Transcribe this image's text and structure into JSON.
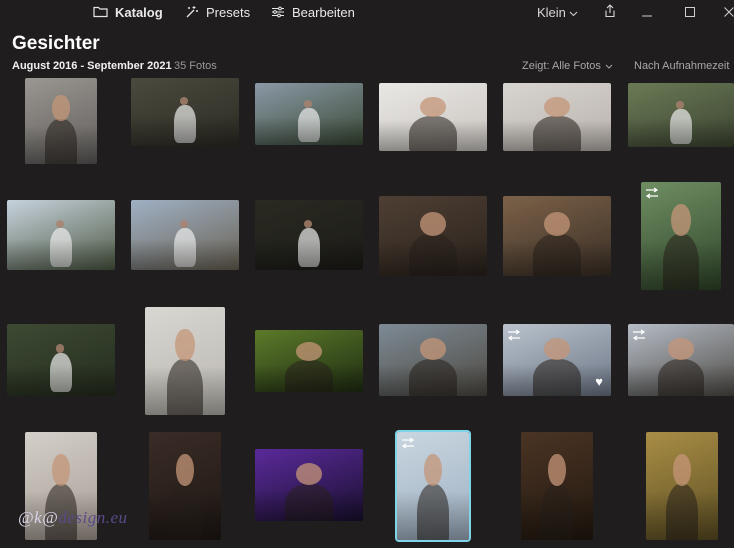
{
  "tabs": [
    {
      "label": "Katalog",
      "icon": "folder-icon",
      "active": true
    },
    {
      "label": "Presets",
      "icon": "magic-wand-icon",
      "active": false
    },
    {
      "label": "Bearbeiten",
      "icon": "sliders-icon",
      "active": false
    }
  ],
  "view": {
    "size_label": "Klein"
  },
  "header": {
    "title": "Gesichter",
    "date_range": "August 2016 - September 2021",
    "count": "35 Fotos",
    "filter_label": "Zeigt: Alle Fotos",
    "sort_label": "Nach Aufnahmezeit"
  },
  "watermark": {
    "prefix": "@k@",
    "suffix": "design.eu"
  },
  "photos": [
    {
      "id": "r1c1",
      "colors": [
        "#9a9792",
        "#5f5c5a"
      ],
      "subject": "portrait"
    },
    {
      "id": "r1c2",
      "colors": [
        "#4b4a3e",
        "#2d2c24"
      ],
      "subject": "bride"
    },
    {
      "id": "r1c3",
      "colors": [
        "#8a99a6",
        "#3b4a36"
      ],
      "subject": "couple"
    },
    {
      "id": "r1c4",
      "colors": [
        "#e9e7e4",
        "#c9c5c0"
      ],
      "subject": "portrait"
    },
    {
      "id": "r1c5",
      "colors": [
        "#d8d4cf",
        "#b9b3ad"
      ],
      "subject": "portrait"
    },
    {
      "id": "r1c6",
      "colors": [
        "#6a7a55",
        "#3d4532"
      ],
      "subject": "couple"
    },
    {
      "id": "r2c1",
      "colors": [
        "#c7d3dd",
        "#4e5a44"
      ],
      "subject": "couple"
    },
    {
      "id": "r2c2",
      "colors": [
        "#9fb0c4",
        "#6a6355"
      ],
      "subject": "couple"
    },
    {
      "id": "r2c3",
      "colors": [
        "#2a2a22",
        "#1c1b17"
      ],
      "subject": "party"
    },
    {
      "id": "r2c4",
      "colors": [
        "#4e3f33",
        "#2a221c"
      ],
      "subject": "portrait"
    },
    {
      "id": "r2c5",
      "colors": [
        "#7b6148",
        "#3a2f26"
      ],
      "subject": "portrait"
    },
    {
      "id": "r2c6",
      "colors": [
        "#6f8e63",
        "#2f4529"
      ],
      "subject": "portrait",
      "edited": true
    },
    {
      "id": "r3c1",
      "colors": [
        "#3d4a33",
        "#242c1e"
      ],
      "subject": "couple"
    },
    {
      "id": "r3c2",
      "colors": [
        "#d9d7d2",
        "#b8b5ae"
      ],
      "subject": "portrait"
    },
    {
      "id": "r3c3",
      "colors": [
        "#5c7a2a",
        "#1f2d12"
      ],
      "subject": "portrait"
    },
    {
      "id": "r3c4",
      "colors": [
        "#7d8a95",
        "#4e4a42"
      ],
      "subject": "portrait"
    },
    {
      "id": "r3c5",
      "colors": [
        "#b9c2cc",
        "#6c7686"
      ],
      "subject": "portrait",
      "edited": true,
      "favorite": true
    },
    {
      "id": "r3c6",
      "colors": [
        "#b6bdc7",
        "#4f4c47"
      ],
      "subject": "portrait",
      "edited": true
    },
    {
      "id": "r4c1",
      "colors": [
        "#d4cfca",
        "#a79c93"
      ],
      "subject": "portrait"
    },
    {
      "id": "r4c2",
      "colors": [
        "#3a2c26",
        "#1e1714"
      ],
      "subject": "portrait"
    },
    {
      "id": "r4c3",
      "colors": [
        "#5a2a9a",
        "#1a1030"
      ],
      "subject": "portrait"
    },
    {
      "id": "r4c4",
      "colors": [
        "#c9d6e0",
        "#9fb0c2"
      ],
      "subject": "portrait",
      "edited": true,
      "selected": true
    },
    {
      "id": "r4c5",
      "colors": [
        "#4a3424",
        "#22180f"
      ],
      "subject": "portrait"
    },
    {
      "id": "r4c6",
      "colors": [
        "#a88d45",
        "#5d4f23"
      ],
      "subject": "portrait"
    }
  ],
  "colors": {
    "background": "#201d1e",
    "selection": "#7fd4e8"
  }
}
